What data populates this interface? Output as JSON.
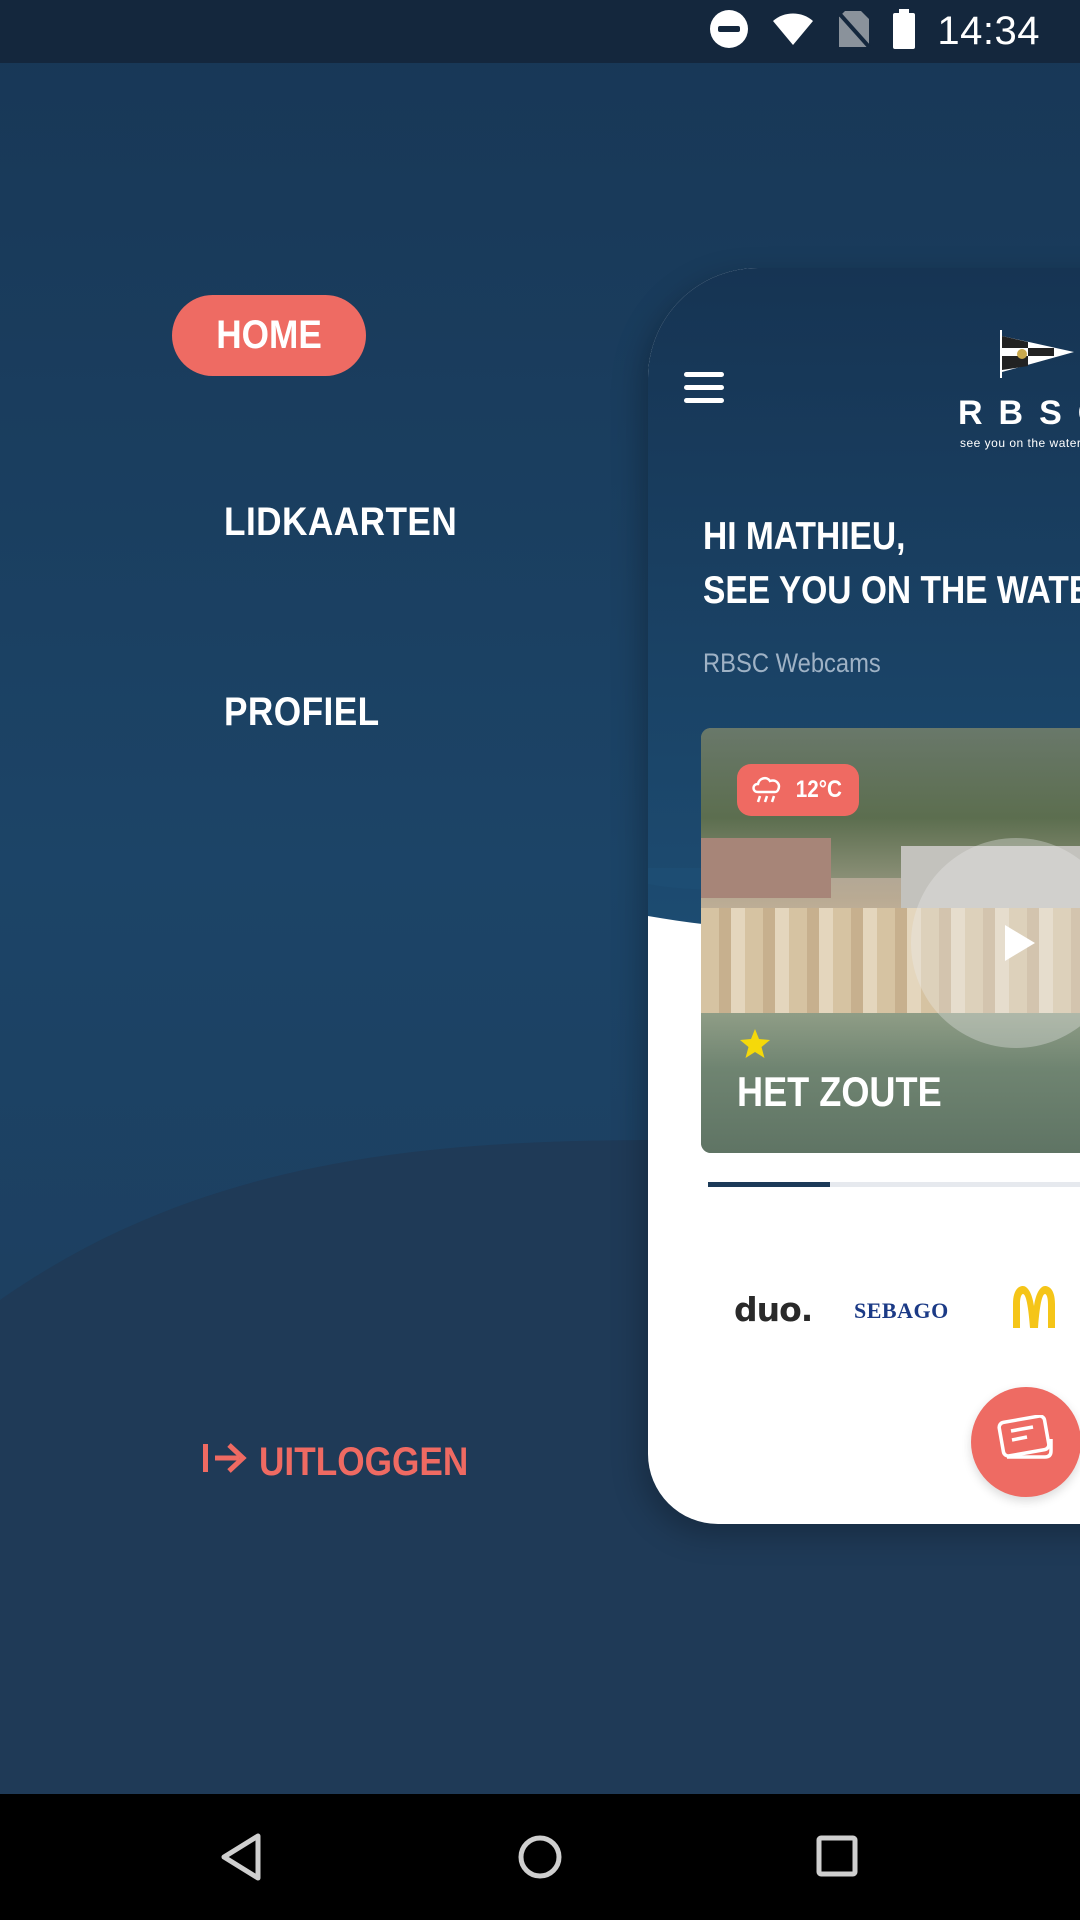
{
  "status_bar": {
    "time": "14:34",
    "icons": [
      "do-not-disturb-icon",
      "wifi-icon",
      "no-sim-icon",
      "battery-icon"
    ]
  },
  "menu": {
    "items": [
      {
        "label": "HOME",
        "active": true
      },
      {
        "label": "LIDKAARTEN",
        "active": false
      },
      {
        "label": "PROFIEL",
        "active": false
      }
    ],
    "logout_label": "UITLOGGEN"
  },
  "preview": {
    "brand_name": "RBSC",
    "brand_tagline": "see you on the water",
    "greeting_line1": "HI MATHIEU,",
    "greeting_line2": "SEE YOU ON THE WATER",
    "webcams_label": "RBSC Webcams",
    "webcam": {
      "temperature": "12°C",
      "weather_icon": "rain-cloud-icon",
      "title": "HET ZOUTE",
      "favorite": true
    },
    "carousel_progress": 0.26,
    "sponsors": [
      "duo.",
      "SEBAGO",
      "McDonald's"
    ]
  },
  "colors": {
    "accent": "#ee6b63",
    "navy": "#1c3a58",
    "background": "#1f3a57"
  }
}
